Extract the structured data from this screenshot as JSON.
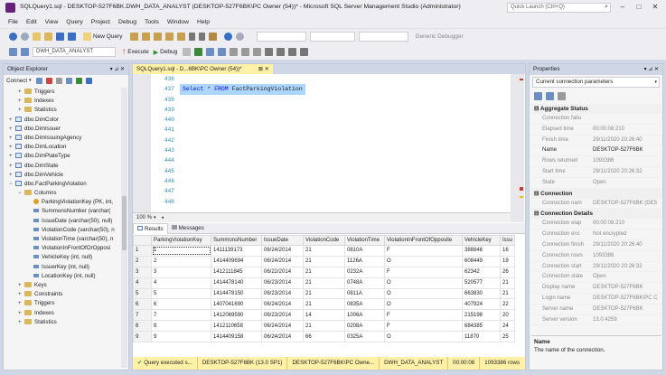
{
  "window": {
    "title": "SQLQuery1.sql - DESKTOP-527F6BK.DWH_DATA_ANALYST (DESKTOP-527F6BK\\PC Owner (54))* - Microsoft SQL Server Management Studio (Administrator)",
    "quick_launch_placeholder": "Quick Launch (Ctrl+Q)"
  },
  "menu": [
    "File",
    "Edit",
    "View",
    "Query",
    "Project",
    "Debug",
    "Tools",
    "Window",
    "Help"
  ],
  "toolbar": {
    "new_query": "New Query",
    "database": "DWH_DATA_ANALYST",
    "execute": "Execute",
    "debug": "Debug",
    "debugger": "Generic Debugger"
  },
  "object_explorer": {
    "title": "Object Explorer",
    "connect": "Connect",
    "tree": [
      {
        "label": "Triggers",
        "type": "folder",
        "indent": 1,
        "expander": "+"
      },
      {
        "label": "Indexes",
        "type": "folder",
        "indent": 1,
        "expander": "+"
      },
      {
        "label": "Statistics",
        "type": "folder",
        "indent": 1,
        "expander": "+"
      },
      {
        "label": "dbo.DimColor",
        "type": "table",
        "indent": 0,
        "expander": "+"
      },
      {
        "label": "dbo.DimIssuer",
        "type": "table",
        "indent": 0,
        "expander": "+"
      },
      {
        "label": "dbo.DimIssuingAgency",
        "type": "table",
        "indent": 0,
        "expander": "+"
      },
      {
        "label": "dbo.DimLocation",
        "type": "table",
        "indent": 0,
        "expander": "+"
      },
      {
        "label": "dbo.DimPlateType",
        "type": "table",
        "indent": 0,
        "expander": "+"
      },
      {
        "label": "dbo.DimState",
        "type": "table",
        "indent": 0,
        "expander": "+"
      },
      {
        "label": "dbo.DimVehicle",
        "type": "table",
        "indent": 0,
        "expander": "+"
      },
      {
        "label": "dbo.FactParkingViolation",
        "type": "table",
        "indent": 0,
        "expander": "−"
      },
      {
        "label": "Columns",
        "type": "folder",
        "indent": 1,
        "expander": "−"
      },
      {
        "label": "ParkingViolationKey (PK, int,",
        "type": "key",
        "indent": 2,
        "expander": ""
      },
      {
        "label": "SummonsNumber (varchar(",
        "type": "col",
        "indent": 2,
        "expander": ""
      },
      {
        "label": "IssueDate (varchar(50), null)",
        "type": "col",
        "indent": 2,
        "expander": ""
      },
      {
        "label": "ViolationCode (varchar(50), n",
        "type": "col",
        "indent": 2,
        "expander": ""
      },
      {
        "label": "ViolationTime (varchar(50), n",
        "type": "col",
        "indent": 2,
        "expander": ""
      },
      {
        "label": "ViolationInFrontOfOrOpposi",
        "type": "col",
        "indent": 2,
        "expander": ""
      },
      {
        "label": "VehicleKey (int, null)",
        "type": "col",
        "indent": 2,
        "expander": ""
      },
      {
        "label": "IssuerKey (int, null)",
        "type": "col",
        "indent": 2,
        "expander": ""
      },
      {
        "label": "LocationKey (int, null)",
        "type": "col",
        "indent": 2,
        "expander": ""
      },
      {
        "label": "Keys",
        "type": "folder",
        "indent": 1,
        "expander": "+"
      },
      {
        "label": "Constraints",
        "type": "folder",
        "indent": 1,
        "expander": "+"
      },
      {
        "label": "Triggers",
        "type": "folder",
        "indent": 1,
        "expander": "+"
      },
      {
        "label": "Indexes",
        "type": "folder",
        "indent": 1,
        "expander": "+"
      },
      {
        "label": "Statistics",
        "type": "folder",
        "indent": 1,
        "expander": "+"
      }
    ]
  },
  "editor": {
    "tab_title": "SQLQuery1.sql - D...6BK\\PC Owner (54))*",
    "line_numbers": [
      "436",
      "437",
      "438",
      "439",
      "440",
      "441",
      "442",
      "443",
      "444",
      "445",
      "446",
      "447",
      "448"
    ],
    "code_keyword1": "Select",
    "code_middle": " * ",
    "code_keyword2": "FROM",
    "code_table": " FactParkingViolation",
    "zoom": "100 %"
  },
  "results": {
    "tabs": [
      "Results",
      "Messages"
    ],
    "columns": [
      "ParkingViolationKey",
      "SummonsNumber",
      "IssueDate",
      "ViolationCode",
      "ViolationTime",
      "ViolationInFrontOfOpposite",
      "VehicleKey",
      "Issu"
    ],
    "rows": [
      [
        "1",
        "1",
        "1411139173",
        "06/24/2014",
        "21",
        "0810A",
        "F",
        "388846",
        "16"
      ],
      [
        "2",
        "2",
        "1414409694",
        "06/24/2014",
        "21",
        "1126A",
        "O",
        "608449",
        "19"
      ],
      [
        "3",
        "3",
        "1412111845",
        "06/22/2014",
        "21",
        "0232A",
        "F",
        "62342",
        "26"
      ],
      [
        "4",
        "4",
        "1414478140",
        "06/23/2014",
        "21",
        "0748A",
        "O",
        "520577",
        "21"
      ],
      [
        "5",
        "5",
        "1414478150",
        "06/23/2014",
        "21",
        "0811A",
        "O",
        "663830",
        "21"
      ],
      [
        "6",
        "6",
        "1407041690",
        "06/24/2014",
        "21",
        "0835A",
        "O",
        "407924",
        "22"
      ],
      [
        "7",
        "7",
        "1412069590",
        "06/23/2014",
        "14",
        "1006A",
        "F",
        "215198",
        "20"
      ],
      [
        "8",
        "8",
        "1412110658",
        "06/24/2014",
        "21",
        "0208A",
        "F",
        "684385",
        "24"
      ],
      [
        "9",
        "9",
        "1414409158",
        "06/24/2014",
        "66",
        "0325A",
        "O",
        "11870",
        "25"
      ]
    ]
  },
  "status": {
    "state": "Query executed s...",
    "server": "DESKTOP-527F6BK (13.0 SP1)",
    "user": "DESKTOP-527F6BK\\PC Owne...",
    "database": "DWH_DATA_ANALYST",
    "elapsed": "00:00:08",
    "rows": "1093386 rows"
  },
  "properties": {
    "title": "Properties",
    "selector": "Current connection parameters",
    "categories": [
      {
        "name": "Aggregate Status",
        "rows": [
          [
            "Connection failu",
            ""
          ],
          [
            "Elapsed time",
            "00:00:08.210"
          ],
          [
            "Finish time",
            "29/11/2020 20:26:40"
          ],
          [
            "Name",
            "DESKTOP-527F6BK"
          ],
          [
            "Rows returned",
            "1093386"
          ],
          [
            "Start time",
            "29/11/2020 20:26:32"
          ],
          [
            "State",
            "Open"
          ]
        ]
      },
      {
        "name": "Connection",
        "rows": [
          [
            "Connection nam",
            "DESKTOP-527F6BK (DE5"
          ]
        ]
      },
      {
        "name": "Connection Details",
        "rows": [
          [
            "Connection elap",
            "00:00:08.210"
          ],
          [
            "Connection enc",
            "Not encrypted"
          ],
          [
            "Connection finish",
            "29/11/2020 20:26:40"
          ],
          [
            "Connection rows",
            "1093386"
          ],
          [
            "Connection start",
            "29/11/2020 20:26:32"
          ],
          [
            "Connection state",
            "Open"
          ],
          [
            "Display name",
            "DESKTOP-527F6BK"
          ],
          [
            "Login name",
            "DESKTOP-527F6BK\\PC C"
          ],
          [
            "Server name",
            "DESKTOP-527F6BK"
          ],
          [
            "Server version",
            "13.0.4259"
          ]
        ]
      }
    ],
    "desc_title": "Name",
    "desc_text": "The name of the connection."
  }
}
